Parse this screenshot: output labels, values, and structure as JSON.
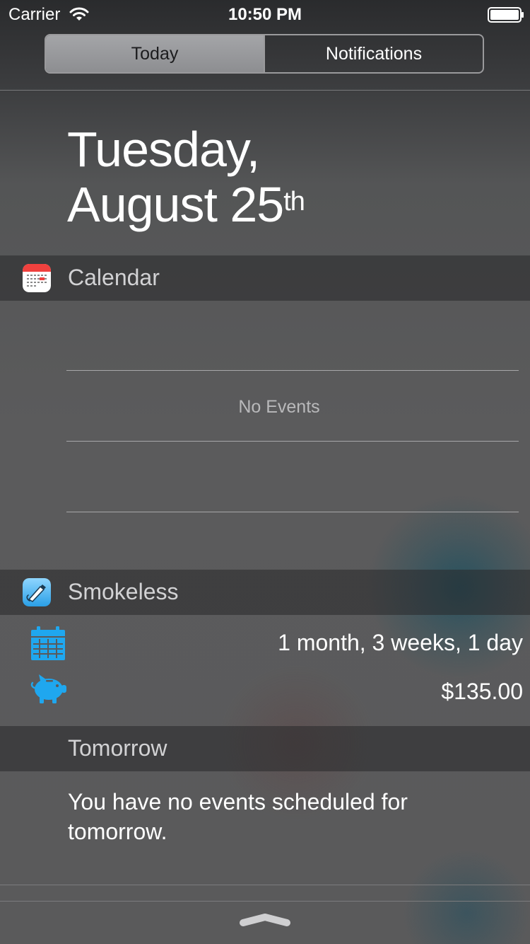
{
  "status_bar": {
    "carrier": "Carrier",
    "time": "10:50 PM"
  },
  "segments": {
    "today": "Today",
    "notifications": "Notifications",
    "selected": "Today"
  },
  "date": {
    "line1": "Tuesday,",
    "line2": "August 25",
    "suffix": "th"
  },
  "calendar_widget": {
    "title": "Calendar",
    "empty_text": "No Events"
  },
  "smokeless_widget": {
    "title": "Smokeless",
    "duration": "1 month, 3 weeks, 1 day",
    "savings": "$135.00"
  },
  "tomorrow": {
    "title": "Tomorrow",
    "text": "You have no events scheduled for tomorrow."
  },
  "icons": {
    "wifi": "wifi-icon",
    "battery": "battery-icon",
    "calendar_app": "calendar-app-icon",
    "smokeless_app": "smokeless-app-icon",
    "calendar_grid": "calendar-grid-icon",
    "piggy_bank": "piggy-bank-icon",
    "grabber": "chevron-up-icon"
  },
  "colors": {
    "accent_blue": "#1fa7ef",
    "calendar_red": "#f0413e"
  }
}
